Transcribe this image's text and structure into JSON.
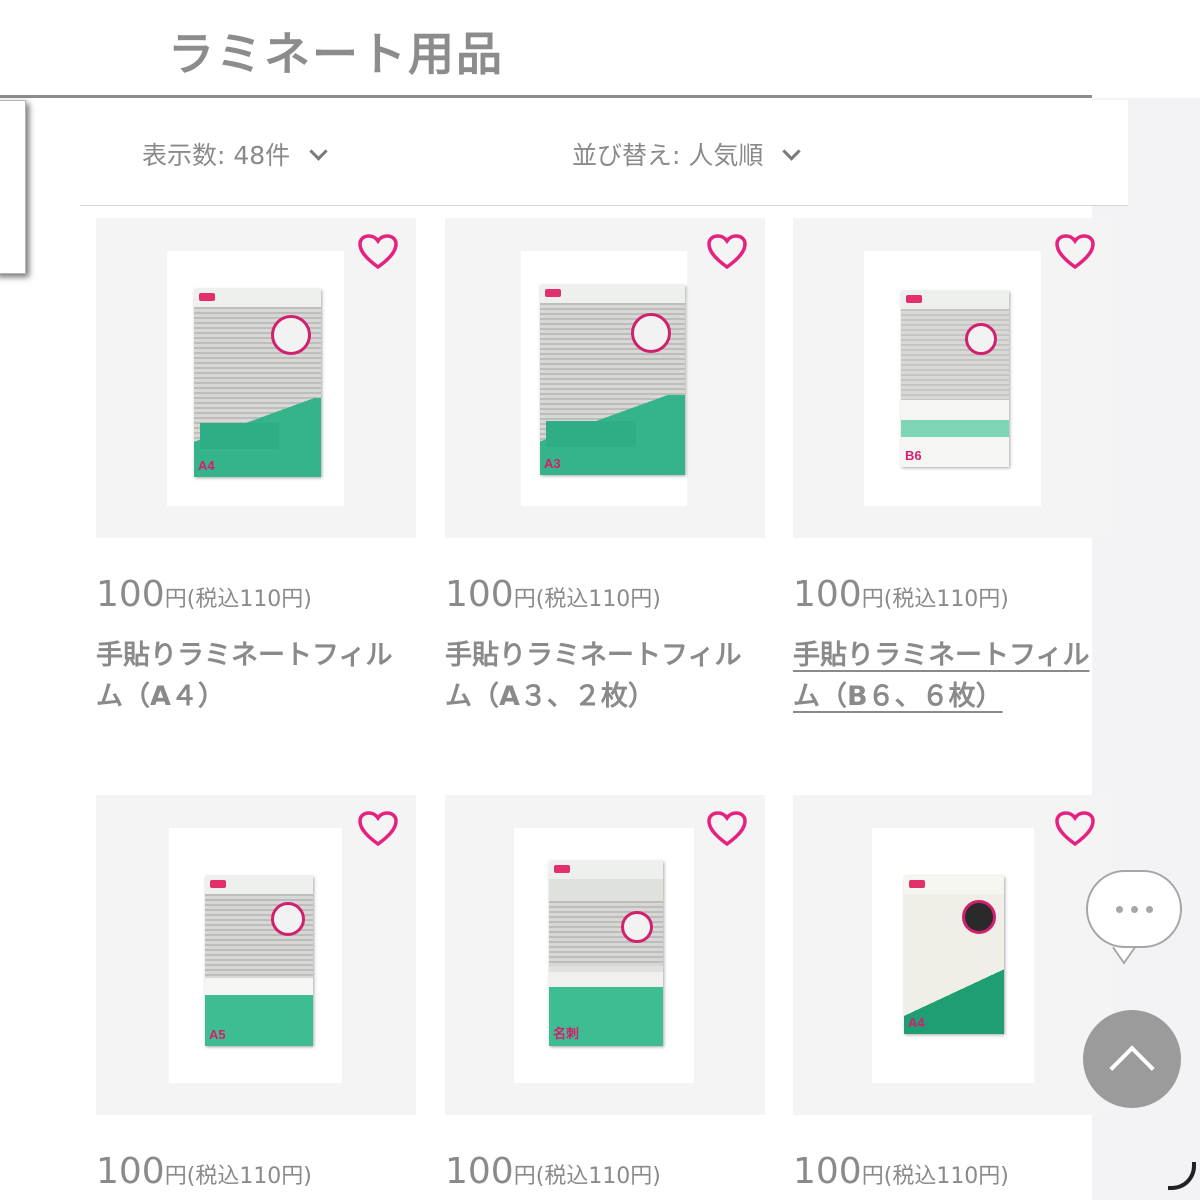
{
  "header": {
    "title": "ラミネート用品"
  },
  "filters": {
    "count_label": "表示数: 48件",
    "sort_label": "並び替え: 人気順"
  },
  "products": [
    {
      "price": "100",
      "yen": "円",
      "tax": "(税込110円)",
      "name": "手貼りラミネートフィルム（A４）",
      "pack_size": "A4"
    },
    {
      "price": "100",
      "yen": "円",
      "tax": "(税込110円)",
      "name": "手貼りラミネートフィルム（A３、２枚）",
      "pack_size": "A3"
    },
    {
      "price": "100",
      "yen": "円",
      "tax": "(税込110円)",
      "name": "手貼りラミネートフィルム（B６、６枚）",
      "pack_size": "B6"
    },
    {
      "price": "100",
      "yen": "円",
      "tax": "(税込110円)",
      "name": "",
      "pack_size": "A5"
    },
    {
      "price": "100",
      "yen": "円",
      "tax": "(税込110円)",
      "name": "",
      "pack_size": "名刺"
    },
    {
      "price": "100",
      "yen": "円",
      "tax": "(税込110円)",
      "name": "",
      "pack_size": "A4"
    }
  ],
  "colors": {
    "heart": "#e5227f",
    "text": "#8a8a8a",
    "accent_green": "#35b48b"
  },
  "icons": {
    "favorite": "heart-icon",
    "chat": "chat-bubble-icon",
    "back_to_top": "chevron-up-icon",
    "loading": "spinner-icon"
  }
}
